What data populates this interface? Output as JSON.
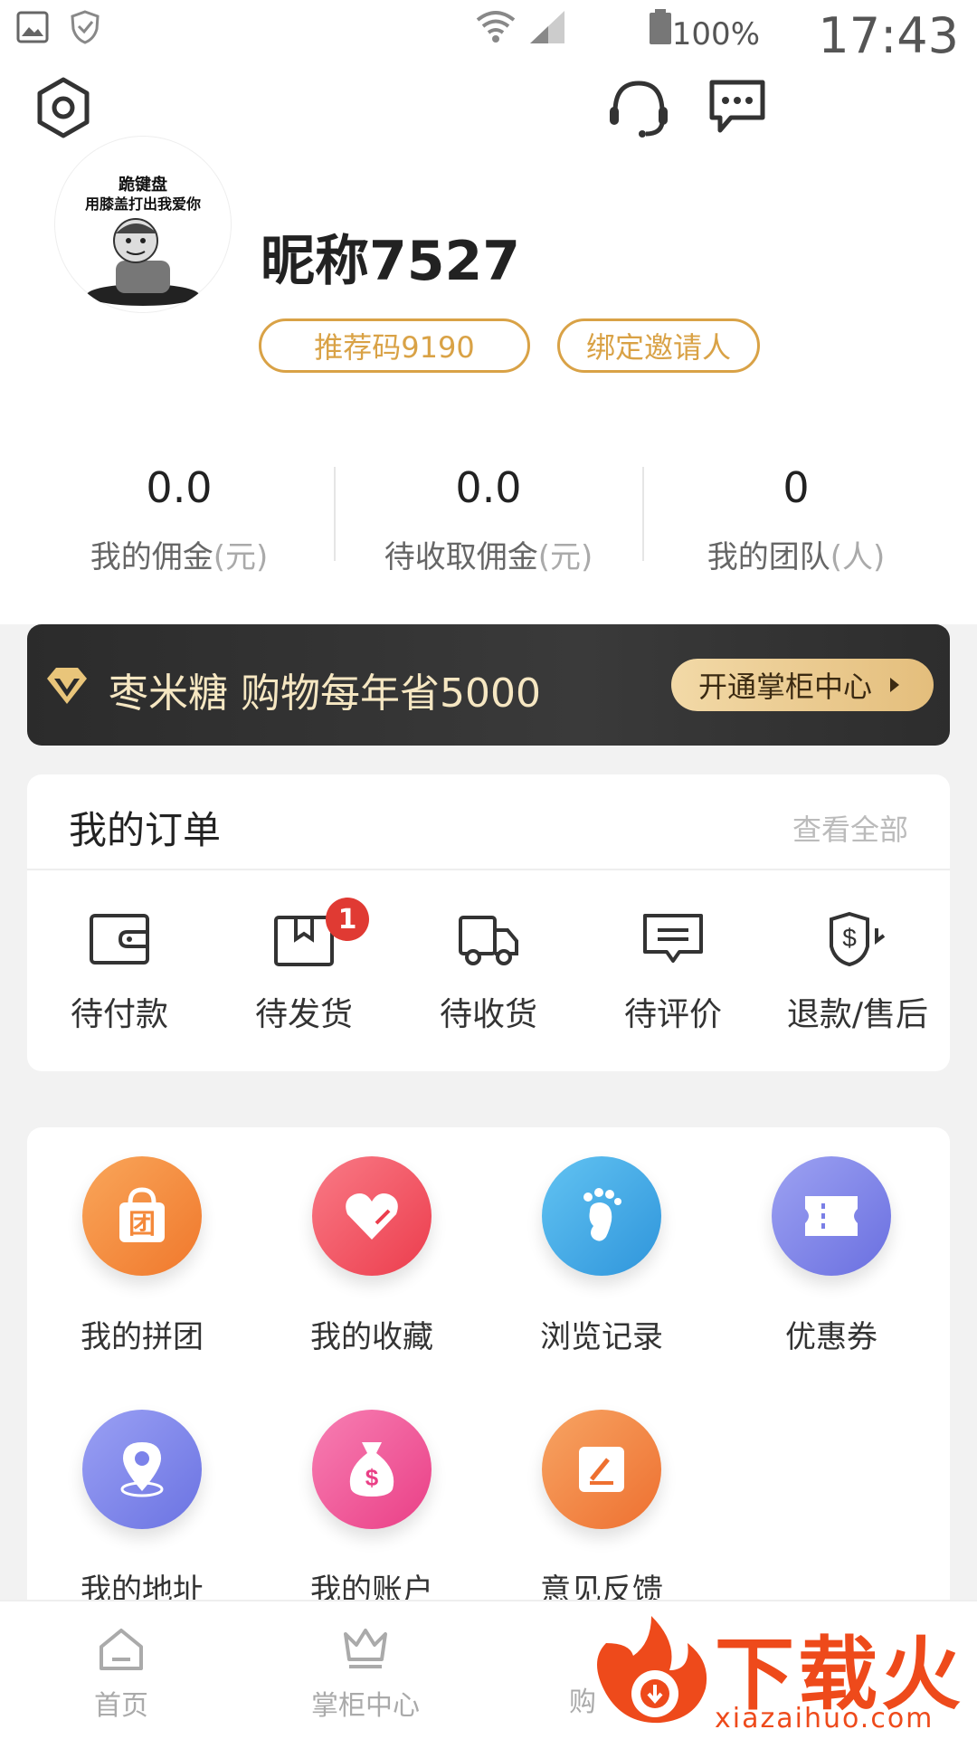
{
  "status_bar": {
    "battery": "100%",
    "time": "17:43"
  },
  "profile": {
    "avatar_caption_1": "跪键盘",
    "avatar_caption_2": "用膝盖打出我爱你",
    "nickname": "昵称7527",
    "referral_code": "推荐码9190",
    "bind_inviter": "绑定邀请人"
  },
  "stats": [
    {
      "value": "0.0",
      "label": "我的佣金",
      "unit": "(元)"
    },
    {
      "value": "0.0",
      "label": "待收取佣金",
      "unit": "(元)"
    },
    {
      "value": "0",
      "label": "我的团队",
      "unit": "(人)"
    }
  ],
  "vip_banner": {
    "text": "枣米糖 购物每年省5000",
    "button": "开通掌柜中心"
  },
  "orders": {
    "title": "我的订单",
    "view_all": "查看全部",
    "items": [
      {
        "label": "待付款",
        "icon": "wallet-icon"
      },
      {
        "label": "待发货",
        "icon": "package-icon",
        "badge": "1"
      },
      {
        "label": "待收货",
        "icon": "truck-icon"
      },
      {
        "label": "待评价",
        "icon": "comment-icon"
      },
      {
        "label": "退款/售后",
        "icon": "refund-icon"
      }
    ]
  },
  "services": [
    {
      "label": "我的拼团",
      "icon": "group-bag-icon",
      "glyph": "团",
      "color": "#f4893b"
    },
    {
      "label": "我的收藏",
      "icon": "heart-icon",
      "color": "#f04b5a"
    },
    {
      "label": "浏览记录",
      "icon": "footprint-icon",
      "color": "#3aa8e6"
    },
    {
      "label": "优惠券",
      "icon": "coupon-icon",
      "color": "#7a7fe6"
    },
    {
      "label": "我的地址",
      "icon": "location-icon",
      "color": "#7b82ea"
    },
    {
      "label": "我的账户",
      "icon": "money-bag-icon",
      "glyph": "$",
      "color": "#f04e93"
    },
    {
      "label": "意见反馈",
      "icon": "feedback-icon",
      "color": "#f2843a"
    }
  ],
  "bottom_nav": [
    {
      "label": "首页",
      "icon": "home-icon"
    },
    {
      "label": "掌柜中心",
      "icon": "crown-icon"
    },
    {
      "label": "购",
      "icon": "cart-icon"
    }
  ],
  "watermark": {
    "text": "下载火",
    "url": "xiazaihuo.com"
  },
  "colors": {
    "accent_gold": "#d9a246",
    "vip_bg": "#2b2b2b",
    "badge_red": "#e03a33"
  }
}
